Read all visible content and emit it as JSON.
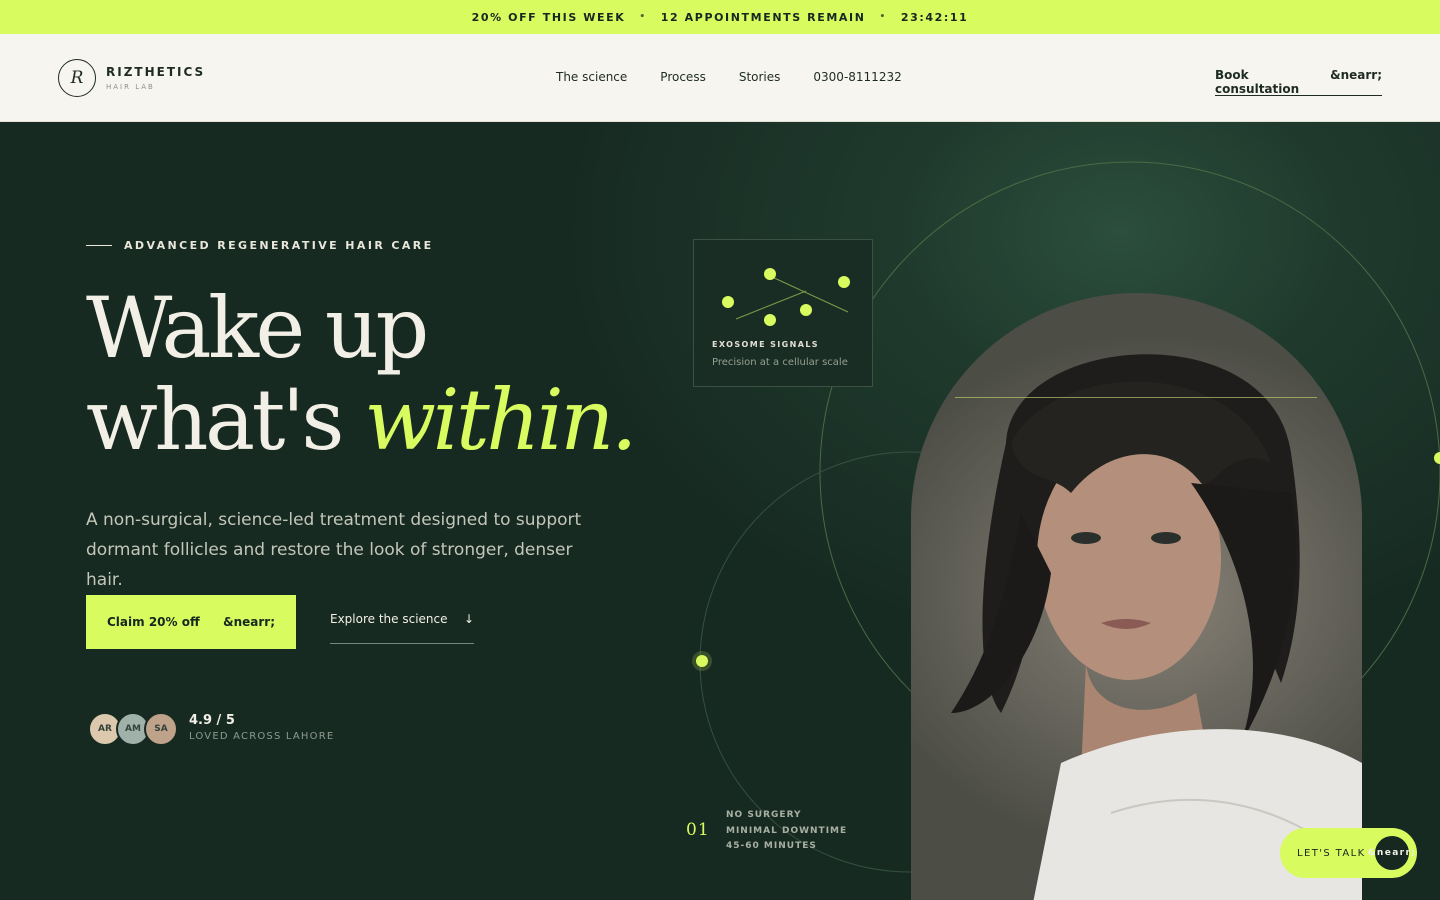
{
  "promo": {
    "offer": "20% OFF THIS WEEK",
    "appointments": "12 APPOINTMENTS REMAIN",
    "countdown": "23:42:11"
  },
  "header": {
    "logo_letter": "R",
    "brand": "RIZTHETICS",
    "brand_sub": "HAIR LAB",
    "nav": [
      "The science",
      "Process",
      "Stories",
      "0300-8111232"
    ],
    "book_label": "Book consultation",
    "book_arrow": "&nearr;"
  },
  "hero": {
    "eyebrow": "ADVANCED REGENERATIVE HAIR CARE",
    "headline_line1": "Wake up",
    "headline_line2": "what's",
    "headline_accent": "within.",
    "subtext": "A non-surgical, science-led treatment designed to support dormant follicles and restore the look of stronger, denser hair.",
    "cta_primary": "Claim 20% off",
    "cta_primary_arrow": "&nearr;",
    "cta_secondary": "Explore the science",
    "cta_secondary_arrow": "↓",
    "avatars": [
      {
        "initials": "AR",
        "color": "#dcc9ad"
      },
      {
        "initials": "AM",
        "color": "#9fb1a8"
      },
      {
        "initials": "SA",
        "color": "#bfa28a"
      }
    ],
    "rating": "4.9 / 5",
    "rating_label": "LOVED ACROSS LAHORE"
  },
  "card": {
    "title": "EXOSOME SIGNALS",
    "subtitle": "Precision at a cellular scale"
  },
  "features": {
    "number": "01",
    "items": [
      "NO SURGERY",
      "MINIMAL DOWNTIME",
      "45-60 MINUTES"
    ]
  },
  "chat": {
    "label": "LET'S TALK",
    "arrow": "&nearr;"
  },
  "colors": {
    "accent": "#d8fb5f",
    "dark": "#172a22",
    "cream": "#f7f5ef"
  }
}
